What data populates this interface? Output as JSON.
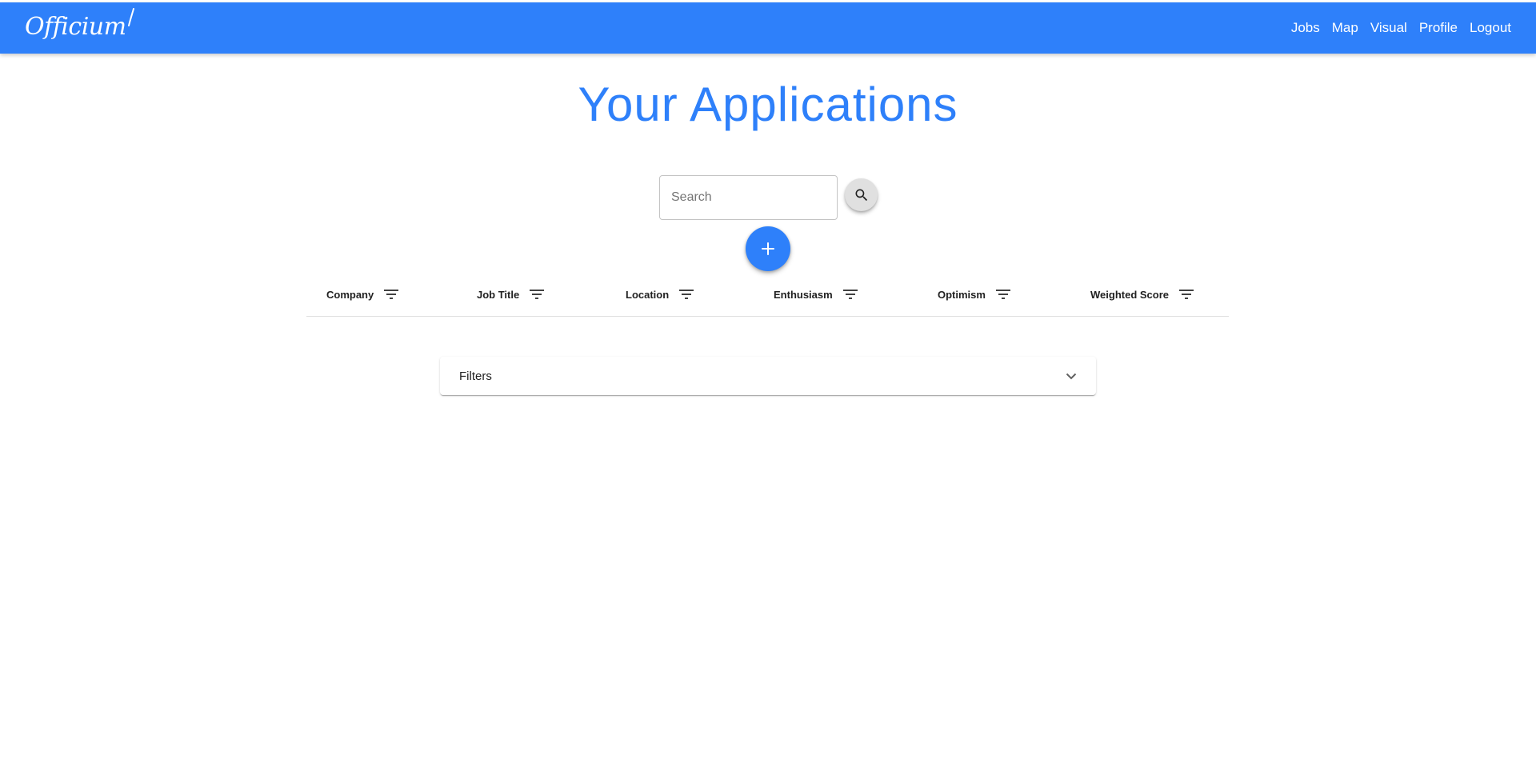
{
  "navbar": {
    "brand": "Officium",
    "links": [
      "Jobs",
      "Map",
      "Visual",
      "Profile",
      "Logout"
    ],
    "color": "#2e80fa"
  },
  "page": {
    "title": "Your Applications"
  },
  "search": {
    "placeholder": "Search",
    "value": ""
  },
  "table": {
    "columns": [
      "Company",
      "Job Title",
      "Location",
      "Enthusiasm",
      "Optimism",
      "Weighted Score"
    ]
  },
  "filters": {
    "label": "Filters"
  }
}
